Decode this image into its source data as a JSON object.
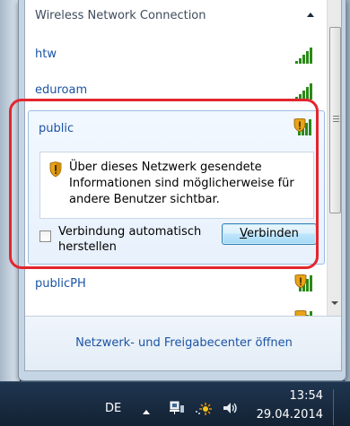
{
  "header": {
    "title": "Wireless Network Connection",
    "collapse_icon": "chevron-up-icon"
  },
  "networks": [
    {
      "name": "htw",
      "secured": true,
      "signal_bars": 5
    },
    {
      "name": "eduroam",
      "secured": true,
      "signal_bars": 5
    }
  ],
  "expanded_network": {
    "name": "public",
    "secured": false,
    "warning_icon": "security-shield-icon",
    "warning_text": "Über dieses Netzwerk gesendete Informationen sind möglicherweise für andere Benutzer sichtbar.",
    "auto_connect_label": "Verbindung automatisch herstellen",
    "auto_connect_checked": false,
    "connect_label_accel": "V",
    "connect_label_rest": "erbinden"
  },
  "networks_after": [
    {
      "name": "publicPH",
      "secured": false,
      "signal_bars": 5
    }
  ],
  "footer": {
    "link": "Netzwerk- und Freigabecenter öffnen"
  },
  "taskbar": {
    "language": "DE",
    "time": "13:54",
    "date": "29.04.2014",
    "icons": [
      "show-hidden-icons-icon",
      "network-icon",
      "action-center-icon",
      "volume-icon"
    ]
  },
  "colors": {
    "link": "#1a54a4",
    "highlight_ring": "#e3262d",
    "signal_green": "#2a8a17",
    "shield_orange": "#e8a317"
  }
}
